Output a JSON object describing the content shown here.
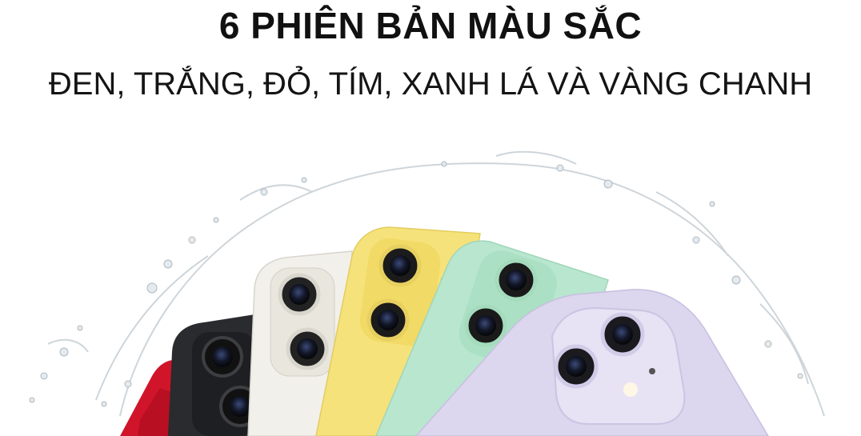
{
  "headline": "6 PHIÊN BẢN MÀU SẮC",
  "subheadline": "ĐEN, TRẮNG, ĐỎ, TÍM, XANH LÁ VÀ VÀNG CHANH",
  "phones": [
    {
      "color_name": "red",
      "hex": "#d0152a"
    },
    {
      "color_name": "black",
      "hex": "#2a2b2e"
    },
    {
      "color_name": "white",
      "hex": "#f2f0ea"
    },
    {
      "color_name": "yellow",
      "hex": "#f6e27a"
    },
    {
      "color_name": "green",
      "hex": "#b9e6cf"
    },
    {
      "color_name": "purple",
      "hex": "#dcd6ee"
    }
  ]
}
